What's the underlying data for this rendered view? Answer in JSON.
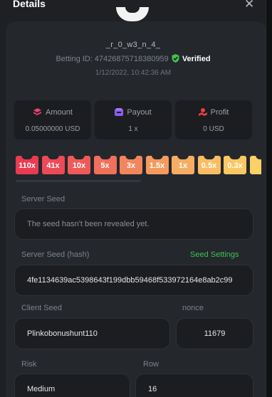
{
  "header": {
    "title": "Details",
    "close_icon": "close-icon"
  },
  "user": {
    "username": "_r_0_w3_n_4_",
    "betting_label": "Betting ID:",
    "betting_id": "47426875718380959",
    "verified_label": "Verified",
    "timestamp": "1/12/2022, 10:42:36 AM"
  },
  "stats": [
    {
      "icon": "money-icon",
      "label": "Amount",
      "value": "0.05000000 USD"
    },
    {
      "icon": "payout-icon",
      "label": "Payout",
      "value": "1 x"
    },
    {
      "icon": "profit-icon",
      "label": "Profit",
      "value": "0 USD"
    }
  ],
  "multipliers": [
    {
      "label": "110x",
      "color": "#ea3b52"
    },
    {
      "label": "41x",
      "color": "#ed4956"
    },
    {
      "label": "10x",
      "color": "#ee5a59"
    },
    {
      "label": "5x",
      "color": "#f1705b"
    },
    {
      "label": "3x",
      "color": "#f3855d"
    },
    {
      "label": "1.5x",
      "color": "#f59a5f"
    },
    {
      "label": "1x",
      "color": "#f6ad63"
    },
    {
      "label": "0.5x",
      "color": "#f8bd62"
    },
    {
      "label": "0.3x",
      "color": "#fac762"
    },
    {
      "label": "",
      "color": "#fbd065"
    }
  ],
  "fields": {
    "server_seed": {
      "label": "Server Seed",
      "value": "The seed hasn't been revealed yet."
    },
    "server_seed_hash": {
      "label": "Server Seed (hash)",
      "link": "Seed Settings",
      "value": "4fe1134639ac5398643f199dbb59468f533972164e8ab2c99"
    },
    "client_seed": {
      "label": "Client Seed",
      "value": "Plinkobonushunt110"
    },
    "nonce": {
      "label": "nonce",
      "value": "11679"
    },
    "risk": {
      "label": "Risk",
      "value": "Medium"
    },
    "row": {
      "label": "Row",
      "value": "16"
    }
  },
  "colors": {
    "accent_green": "#3fc24f",
    "background": "#1e2024"
  }
}
